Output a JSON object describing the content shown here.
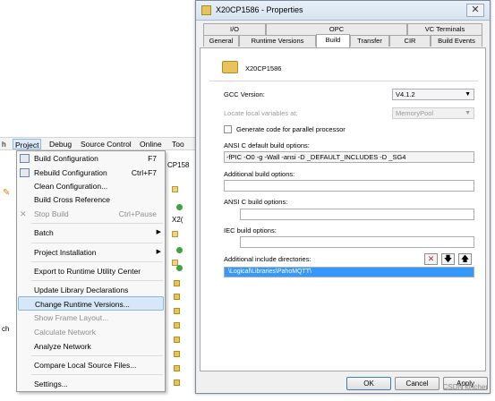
{
  "menubar": {
    "items": [
      "Project",
      "Debug",
      "Source Control",
      "Online",
      "Too"
    ]
  },
  "ide_fragments": {
    "left_edge_h": "h",
    "left_edge_ch": "ch",
    "label_cp": "CP158",
    "label_x2": "X2("
  },
  "project_menu": {
    "build_configuration": {
      "label": "Build Configuration",
      "shortcut": "F7"
    },
    "rebuild_configuration": {
      "label": "Rebuild Configuration",
      "shortcut": "Ctrl+F7"
    },
    "clean_configuration": {
      "label": "Clean Configuration..."
    },
    "build_cross_reference": {
      "label": "Build Cross Reference"
    },
    "stop_build": {
      "label": "Stop Build",
      "shortcut": "Ctrl+Pause"
    },
    "batch": {
      "label": "Batch"
    },
    "project_installation": {
      "label": "Project Installation"
    },
    "export_runtime_utility": {
      "label": "Export to Runtime Utility Center"
    },
    "update_library": {
      "label": "Update Library Declarations"
    },
    "change_runtime": {
      "label": "Change Runtime Versions..."
    },
    "show_frame_layout": {
      "label": "Show Frame Layout..."
    },
    "calculate_network": {
      "label": "Calculate Network"
    },
    "analyze_network": {
      "label": "Analyze Network"
    },
    "compare_local_source": {
      "label": "Compare Local Source Files..."
    },
    "settings": {
      "label": "Settings..."
    }
  },
  "dialog": {
    "title": "X20CP1586 - Properties",
    "close_glyph": "✕",
    "tabs_row1": [
      "I/O",
      "OPC",
      "VC Terminals"
    ],
    "tabs_row2": [
      "General",
      "Runtime Versions",
      "Build",
      "Transfer",
      "CIR",
      "Build Events"
    ],
    "active_tab": "Build",
    "header_name": "X20CP1586",
    "gcc_version_label": "GCC Version:",
    "gcc_version_value": "V4.1.2",
    "locate_vars_label": "Locate local variables at:",
    "locate_vars_value": "MemoryPool",
    "parallel_label": "Generate code for parallel processor",
    "ansi_default_label": "ANSI C default build options:",
    "ansi_default_value": "-fPIC -O0 -g -Wall -ansi -D _DEFAULT_INCLUDES -D _SG4",
    "additional_build_label": "Additional build options:",
    "additional_build_value": "",
    "ansi_build_label": "ANSI C build options:",
    "ansi_build_value": "",
    "iec_build_label": "IEC build options:",
    "iec_build_value": "",
    "include_dirs_label": "Additional include directories:",
    "include_dirs": [
      "\\Logical\\Libraries\\PahoMQTT\\"
    ],
    "delete_glyph": "✕",
    "down_glyph": "🡇",
    "up_glyph": "🡅",
    "ok_label": "OK",
    "cancel_label": "Cancel",
    "apply_label": "Apply"
  },
  "watermark": "CSDN @lcher",
  "colors": {
    "selection": "#3399ff",
    "menu_highlight": "#d6e8f8",
    "delete_red": "#c0262a"
  }
}
